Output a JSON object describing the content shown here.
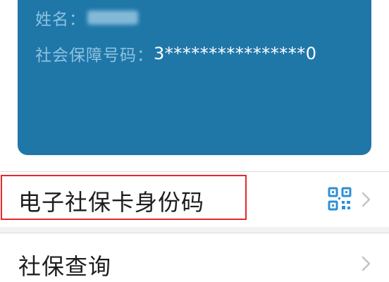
{
  "card": {
    "name_label": "姓名：",
    "ssn_label": "社会保障号码：",
    "ssn_value": "3****************0"
  },
  "menu": {
    "items": [
      {
        "label": "电子社保卡身份码",
        "icon": "qr-code-icon",
        "highlighted": true
      },
      {
        "label": "社保查询",
        "icon": "chevron-right-icon",
        "highlighted": false
      }
    ]
  },
  "colors": {
    "card_bg": "#1f77a8",
    "card_label": "#8ec2e1",
    "accent_icon": "#2f8fd6",
    "highlight_border": "#e22a2a"
  }
}
